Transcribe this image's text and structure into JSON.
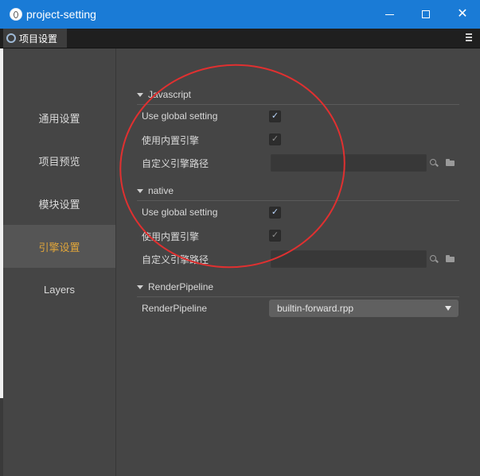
{
  "window": {
    "title": "project-setting"
  },
  "tab": {
    "label": "项目设置"
  },
  "sidebar": {
    "items": [
      {
        "label": "通用设置"
      },
      {
        "label": "项目预览"
      },
      {
        "label": "模块设置"
      },
      {
        "label": "引擎设置",
        "active": true
      },
      {
        "label": "Layers"
      }
    ]
  },
  "sections": {
    "javascript": {
      "title": "Javascript",
      "use_global_label": "Use global setting",
      "use_global_checked": true,
      "builtin_label": "使用内置引擎",
      "builtin_checked": true,
      "custom_path_label": "自定义引擎路径",
      "custom_path_value": ""
    },
    "native": {
      "title": "native",
      "use_global_label": "Use global setting",
      "use_global_checked": true,
      "builtin_label": "使用内置引擎",
      "builtin_checked": true,
      "custom_path_label": "自定义引擎路径",
      "custom_path_value": ""
    },
    "render_pipeline": {
      "title": "RenderPipeline",
      "label": "RenderPipeline",
      "value": "builtin-forward.rpp"
    }
  },
  "colors": {
    "titlebar": "#1a7bd6",
    "active_nav_text": "#e0a53a",
    "annotation": "#e03030"
  }
}
